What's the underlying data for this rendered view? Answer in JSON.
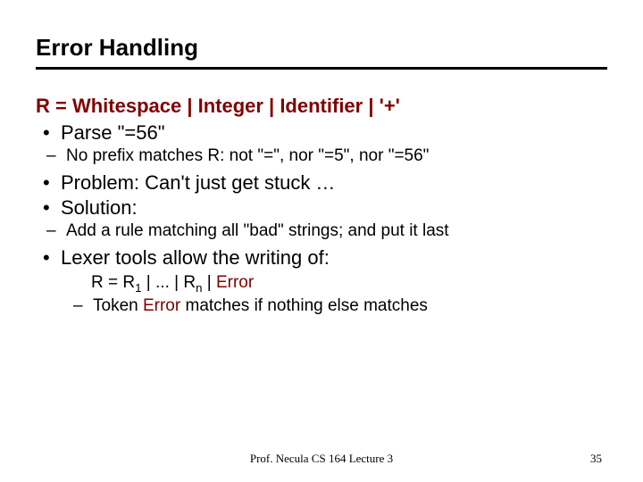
{
  "title": "Error Handling",
  "ruleDef": "R = Whitespace | Integer | Identifier | '+'",
  "b1": "Parse \"=56\"",
  "s1": "No prefix matches R: not \"=\", nor \"=5\", nor \"=56\"",
  "b2": "Problem: Can't just get stuck …",
  "b3": "Solution:",
  "s2": "Add a rule matching all \"bad\" strings; and put it last",
  "b4": "Lexer tools allow the writing of:",
  "formula_pre": "R = R",
  "formula_sub1": "1",
  "formula_mid": " | ... | R",
  "formula_sub2": "n",
  "formula_bar": " | ",
  "formula_err": "Error",
  "s3_pre": "Token ",
  "s3_err": "Error",
  "s3_post": " matches if nothing else matches",
  "footer": "Prof. Necula  CS 164  Lecture 3",
  "page": "35"
}
